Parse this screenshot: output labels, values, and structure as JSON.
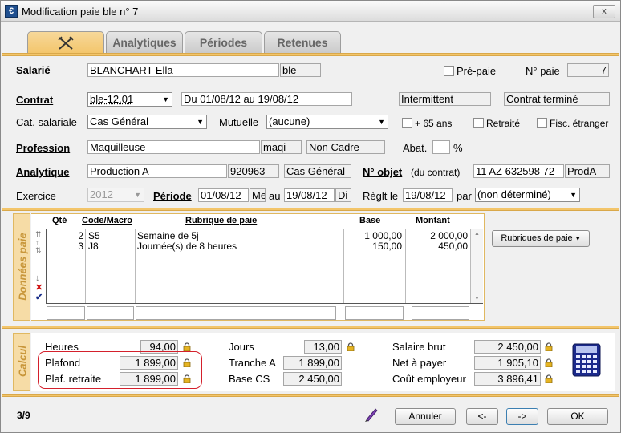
{
  "window": {
    "title": "Modification paie ble n° 7",
    "close": "x"
  },
  "tabs": [
    "",
    "Analytiques",
    "Périodes",
    "Retenues"
  ],
  "salarie": {
    "label": "Salarié",
    "name": "BLANCHART Ella",
    "code": "ble",
    "prepaie_label": "Pré-paie",
    "npaie_label": "N° paie",
    "npaie": "7"
  },
  "contrat": {
    "label": "Contrat",
    "value": "ble-12.01",
    "period": "Du 01/08/12 au 19/08/12",
    "type": "Intermittent",
    "status": "Contrat terminé"
  },
  "cat": {
    "label": "Cat. salariale",
    "value": "Cas Général",
    "mutuelle_label": "Mutuelle",
    "mutuelle": "(aucune)",
    "plus65": "+ 65 ans",
    "retraite": "Retraité",
    "fisc": "Fisc. étranger"
  },
  "profession": {
    "label": "Profession",
    "value": "Maquilleuse",
    "code": "maqi",
    "cadre": "Non Cadre",
    "abat_label": "Abat.",
    "abat": "",
    "percent": "%"
  },
  "analytique": {
    "label": "Analytique",
    "value": "Production A",
    "code": "920963",
    "cas": "Cas Général",
    "nobjet_label": "N° objet",
    "nobjet_sub": "(du contrat)",
    "nobjet": "11 AZ 632598 72",
    "nobjet2": "ProdA"
  },
  "exercice": {
    "label": "Exercice",
    "value": "2012",
    "periode_label": "Période",
    "from": "01/08/12",
    "from_day": "Me",
    "au": "au",
    "to": "19/08/12",
    "to_day": "Di",
    "reglt_label": "Règlt le",
    "reglt": "19/08/12",
    "par": "par",
    "mode": "(non déterminé)"
  },
  "donnees": {
    "side_label": "Données paie",
    "headers": {
      "qte": "Qté",
      "code": "Code",
      "slash": "/",
      "macro": "Macro",
      "rubrique": "Rubrique de paie",
      "base": "Base",
      "montant": "Montant"
    },
    "rows": [
      {
        "qte": "2",
        "code": "S5",
        "rubrique": "Semaine de 5j",
        "base": "1 000,00",
        "montant": "2 000,00"
      },
      {
        "qte": "3",
        "code": "J8",
        "rubrique": "Journée(s) de 8 heures",
        "base": "150,00",
        "montant": "450,00"
      }
    ],
    "rubriques_button": "Rubriques de paie"
  },
  "calcul": {
    "side_label": "Calcul",
    "heures_label": "Heures",
    "heures": "94,00",
    "plafond_label": "Plafond",
    "plafond": "1 899,00",
    "plaf_retraite_label": "Plaf. retraite",
    "plaf_retraite": "1 899,00",
    "jours_label": "Jours",
    "jours": "13,00",
    "tranche_label": "Tranche A",
    "tranche": "1 899,00",
    "basecs_label": "Base CS",
    "basecs": "2 450,00",
    "brut_label": "Salaire brut",
    "brut": "2 450,00",
    "net_label": "Net à payer",
    "net": "1 905,10",
    "cout_label": "Coût employeur",
    "cout": "3 896,41"
  },
  "footer": {
    "page": "3/9",
    "annuler": "Annuler",
    "prev": "<-",
    "next": "->",
    "ok": "OK"
  },
  "colors": {
    "accent": "#f3c56a",
    "highlight": "#d4202c"
  }
}
